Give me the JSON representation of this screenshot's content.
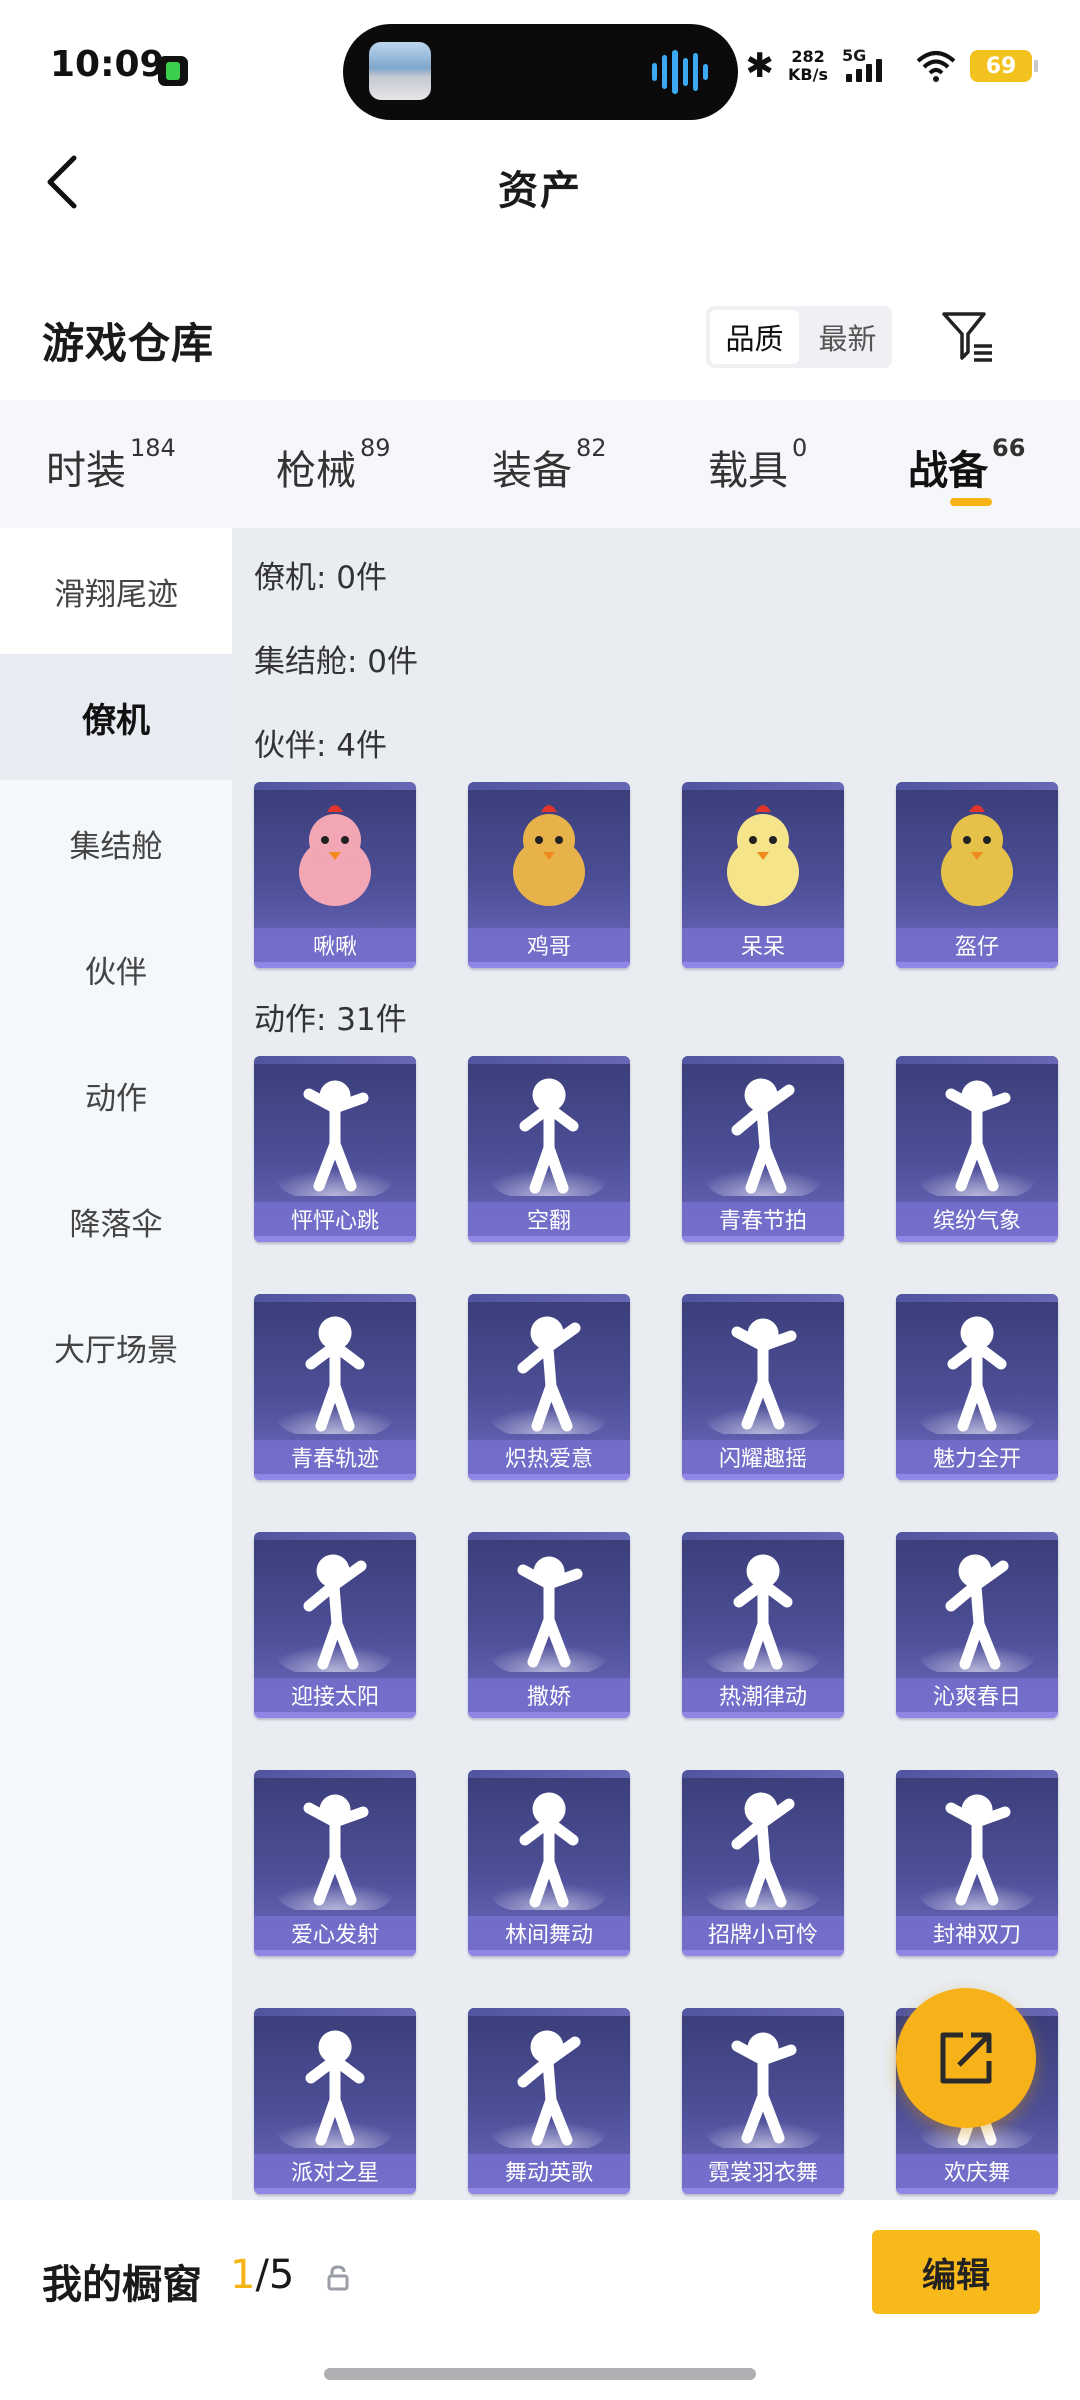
{
  "status_bar": {
    "time": "10:09",
    "net_speed_value": "282",
    "net_speed_unit": "KB/s",
    "network": "5G",
    "battery": "69"
  },
  "header": {
    "title": "资产"
  },
  "warehouse": {
    "title": "游戏仓库",
    "sort_options": [
      "品质",
      "最新"
    ],
    "sort_selected": "品质"
  },
  "tabs": [
    {
      "label": "时装",
      "count": "184"
    },
    {
      "label": "枪械",
      "count": "89"
    },
    {
      "label": "装备",
      "count": "82"
    },
    {
      "label": "载具",
      "count": "0"
    },
    {
      "label": "战备",
      "count": "66"
    }
  ],
  "active_tab": "战备",
  "sidebar": {
    "items": [
      "滑翔尾迹",
      "僚机",
      "集结舱",
      "伙伴",
      "动作",
      "降落伞",
      "大厅场景"
    ],
    "active": "僚机"
  },
  "groups": {
    "wingman": "僚机: 0件",
    "capsule": "集结舱: 0件",
    "partner": "伙伴: 4件",
    "emote": "动作: 31件"
  },
  "partners": [
    "啾啾",
    "鸡哥",
    "呆呆",
    "盔仔"
  ],
  "emotes": [
    "怦怦心跳",
    "空翻",
    "青春节拍",
    "缤纷气象",
    "青春轨迹",
    "炽热爱意",
    "闪耀趣摇",
    "魅力全开",
    "迎接太阳",
    "撒娇",
    "热潮律动",
    "沁爽春日",
    "爱心发射",
    "林间舞动",
    "招牌小可怜",
    "封神双刀",
    "派对之星",
    "舞动英歌",
    "霓裳羽衣舞",
    "欢庆舞"
  ],
  "bottom": {
    "showcase_title": "我的橱窗",
    "showcase_current": "1",
    "showcase_total": "/5",
    "edit_label": "编辑"
  },
  "colors": {
    "accent": "#f5b316",
    "card_top": "#3a3d78",
    "card_bottom": "#6e6bc2",
    "label_strip": "#7670cd"
  }
}
